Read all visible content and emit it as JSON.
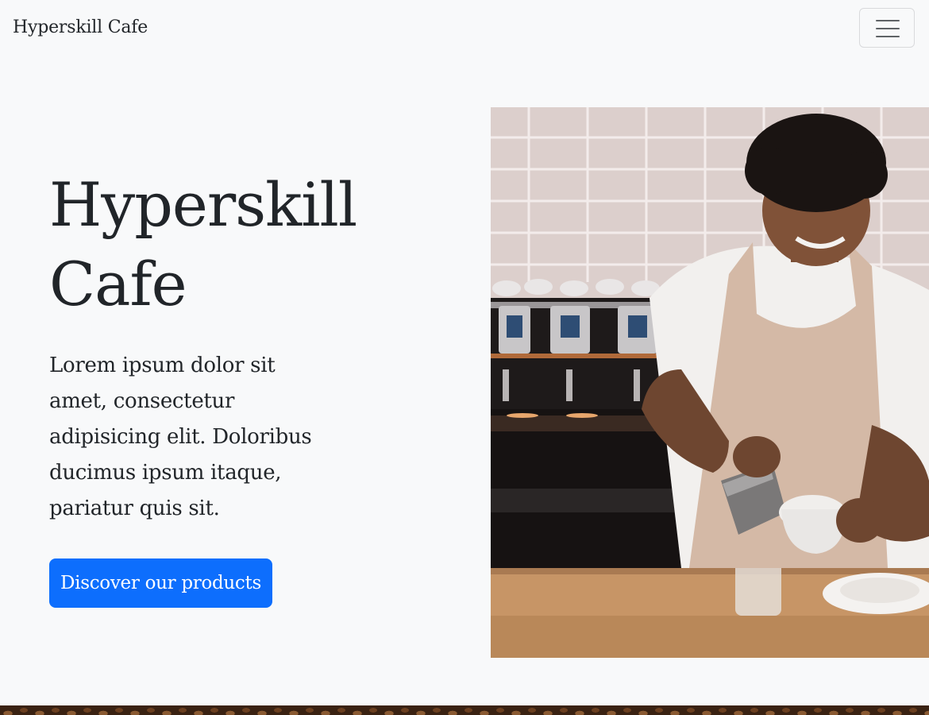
{
  "navbar": {
    "brand": "Hyperskill Cafe",
    "toggler_icon": "menu-hamburger-icon"
  },
  "hero": {
    "title": "Hyperskill Cafe",
    "text": "Lorem ipsum dolor sit amet, consectetur adipisicing elit. Doloribus ducimus ipsum itaque, pariatur quis sit.",
    "cta_label": "Discover our products",
    "image_subject": "barista pouring milk into a coffee cup"
  },
  "colors": {
    "background": "#f8f9fa",
    "primary_button": "#0d6efd",
    "text": "#212529"
  }
}
